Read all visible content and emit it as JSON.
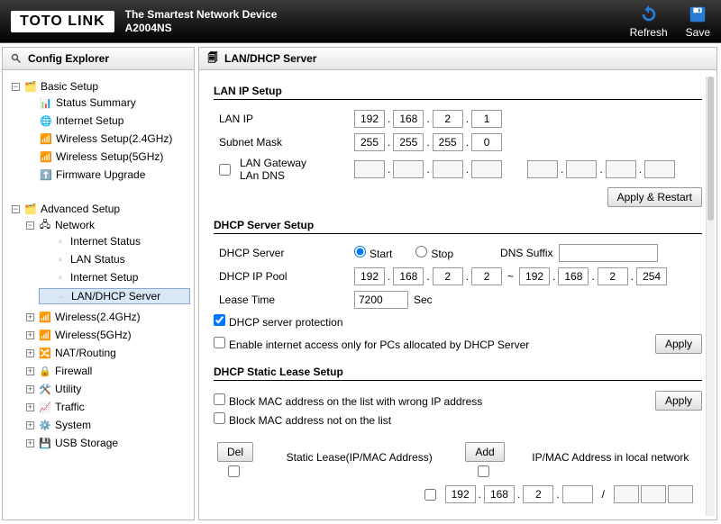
{
  "header": {
    "brand": "TOTO LINK",
    "tagline1": "The Smartest Network Device",
    "tagline2": "A2004NS",
    "refresh": "Refresh",
    "save": "Save"
  },
  "sidebar": {
    "title": "Config Explorer",
    "basic": {
      "label": "Basic Setup",
      "items": [
        "Status Summary",
        "Internet Setup",
        "Wireless Setup(2.4GHz)",
        "Wireless Setup(5GHz)",
        "Firmware Upgrade"
      ]
    },
    "advanced": {
      "label": "Advanced Setup",
      "network": {
        "label": "Network",
        "items": [
          "Internet Status",
          "LAN Status",
          "Internet Setup",
          "LAN/DHCP Server"
        ]
      },
      "rest": [
        "Wireless(2.4GHz)",
        "Wireless(5GHz)",
        "NAT/Routing",
        "Firewall",
        "Utility",
        "Traffic",
        "System",
        "USB Storage"
      ]
    }
  },
  "content": {
    "title": "LAN/DHCP Server",
    "lan": {
      "section": "LAN IP Setup",
      "ip_label": "LAN IP",
      "ip": [
        "192",
        "168",
        "2",
        "1"
      ],
      "mask_label": "Subnet Mask",
      "mask": [
        "255",
        "255",
        "255",
        "0"
      ],
      "gw_chk_label": "LAN Gateway\nLAn DNS",
      "apply": "Apply & Restart"
    },
    "dhcp": {
      "section": "DHCP Server Setup",
      "srv_label": "DHCP Server",
      "start": "Start",
      "stop": "Stop",
      "dns_suffix": "DNS Suffix",
      "pool_label": "DHCP IP Pool",
      "pool_from": [
        "192",
        "168",
        "2",
        "2"
      ],
      "pool_to": [
        "192",
        "168",
        "2",
        "254"
      ],
      "lease_label": "Lease Time",
      "lease": "7200",
      "lease_unit": "Sec",
      "prot": "DHCP server protection",
      "only": "Enable internet access only for PCs allocated by DHCP Server",
      "apply": "Apply"
    },
    "static": {
      "section": "DHCP Static Lease Setup",
      "block_wrong": "Block MAC address on the list with wrong IP address",
      "block_not": "Block MAC address not on the list",
      "apply": "Apply",
      "del": "Del",
      "add": "Add",
      "col1": "Static Lease(IP/MAC Address)",
      "col2": "IP/MAC Address in local network",
      "row_ip": [
        "192",
        "168",
        "2",
        ""
      ]
    }
  }
}
